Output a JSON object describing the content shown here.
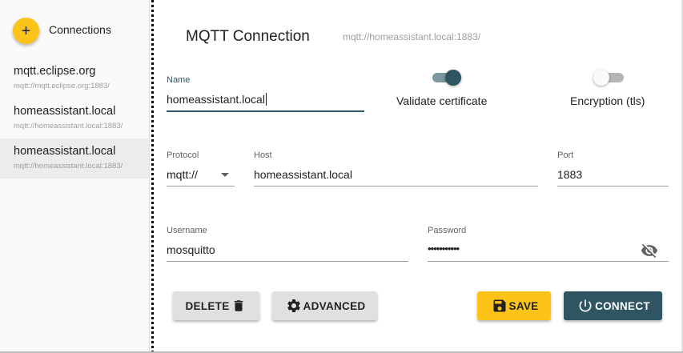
{
  "sidebar": {
    "add_symbol": "+",
    "title": "Connections",
    "items": [
      {
        "name": "mqtt.eclipse.org",
        "url": "mqtt://mqtt.eclipse.org:1883/",
        "selected": false
      },
      {
        "name": "homeassistant.local",
        "url": "mqtt://homeassistant.local:1883/",
        "selected": false
      },
      {
        "name": "homeassistant.local",
        "url": "mqtt://homeassistant.local:1883/",
        "selected": true
      }
    ]
  },
  "header": {
    "title": "MQTT Connection",
    "url": "mqtt://homeassistant.local:1883/"
  },
  "form": {
    "name": {
      "label": "Name",
      "value": "homeassistant.local"
    },
    "validate_certificate": {
      "label": "Validate certificate",
      "checked": true
    },
    "encryption": {
      "label": "Encryption (tls)",
      "checked": false
    },
    "protocol": {
      "label": "Protocol",
      "value": "mqtt://"
    },
    "host": {
      "label": "Host",
      "value": "homeassistant.local"
    },
    "port": {
      "label": "Port",
      "value": "1883"
    },
    "username": {
      "label": "Username",
      "value": "mosquitto"
    },
    "password": {
      "label": "Password",
      "value": "•••••••••••"
    }
  },
  "actions": {
    "delete_label": "DELETE",
    "advanced_label": "ADVANCED",
    "save_label": "SAVE",
    "connect_label": "CONNECT"
  },
  "colors": {
    "accent": "#fcc419",
    "primary": "#2f5563",
    "toggle_on_track": "#7c97a0",
    "toggle_off_track": "#b5b5b5"
  },
  "icons": {
    "add": "plus-icon",
    "delete": "trash-icon",
    "advanced": "gear-icon",
    "save": "floppy-disk-icon",
    "connect": "power-icon",
    "password": "visibility-off-icon",
    "protocol": "chevron-down-icon"
  }
}
